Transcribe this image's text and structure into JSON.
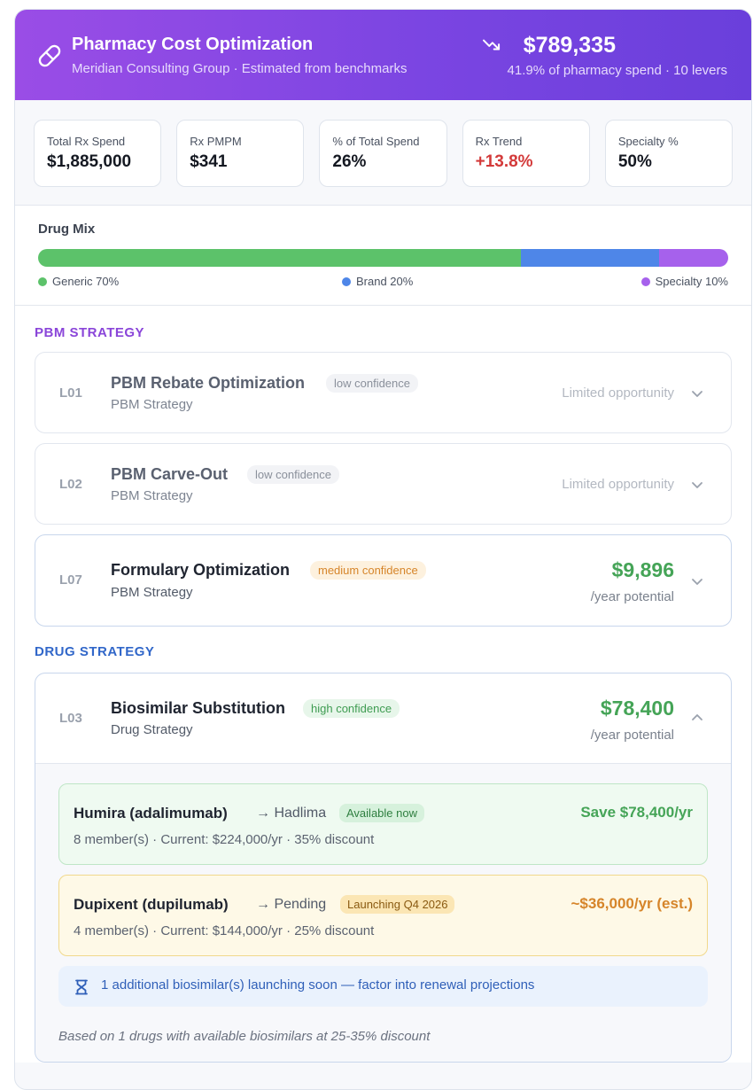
{
  "header": {
    "title": "Pharmacy Cost Optimization",
    "subtitle": "Meridian Consulting Group · Estimated from benchmarks",
    "total": "$789,335",
    "total_sub": "41.9% of pharmacy spend · 10 levers",
    "icons": {
      "logo": "pill-icon",
      "trend": "trending-down-icon"
    }
  },
  "stats": [
    {
      "label": "Total Rx Spend",
      "value": "$1,885,000"
    },
    {
      "label": "Rx PMPM",
      "value": "$341"
    },
    {
      "label": "% of Total Spend",
      "value": "26%"
    },
    {
      "label": "Rx Trend",
      "value": "+13.8%"
    },
    {
      "label": "Specialty %",
      "value": "50%"
    }
  ],
  "drug_mix": {
    "title": "Drug Mix",
    "segments": [
      {
        "label": "Generic 70%",
        "percent": 70,
        "color": "#5cc26a"
      },
      {
        "label": "Brand 20%",
        "percent": 20,
        "color": "#4e86e8"
      },
      {
        "label": "Specialty 10%",
        "percent": 10,
        "color": "#a661ec"
      }
    ]
  },
  "sections": {
    "pbm": {
      "title": "PBM STRATEGY"
    },
    "drug": {
      "title": "DRUG STRATEGY"
    }
  },
  "levers": {
    "l01": {
      "code": "L01",
      "name": "PBM Rebate Optimization",
      "confidence": "low confidence",
      "category": "PBM Strategy",
      "status": "Limited opportunity"
    },
    "l02": {
      "code": "L02",
      "name": "PBM Carve-Out",
      "confidence": "low confidence",
      "category": "PBM Strategy",
      "status": "Limited opportunity"
    },
    "l07": {
      "code": "L07",
      "name": "Formulary Optimization",
      "confidence": "medium confidence",
      "category": "PBM Strategy",
      "amount": "$9,896",
      "per": "/year potential"
    },
    "l03": {
      "code": "L03",
      "name": "Biosimilar Substitution",
      "confidence": "high confidence",
      "category": "Drug Strategy",
      "amount": "$78,400",
      "per": "/year potential",
      "drugs": [
        {
          "name": "Humira (adalimumab)",
          "arrow": "→ Hadlima",
          "tag": "Available now",
          "save": "Save $78,400/yr",
          "detail": "8 member(s) · Current: $224,000/yr · 35% discount"
        },
        {
          "name": "Dupixent (dupilumab)",
          "arrow": "→ Pending",
          "tag": "Launching Q4 2026",
          "save": "~$36,000/yr (est.)",
          "detail": "4 member(s) · Current: $144,000/yr · 25% discount"
        }
      ],
      "notice": "1 additional biosimilar(s) launching soon — factor into renewal projections",
      "footnote": "Based on 1 drugs with available biosimilars at 25-35% discount"
    }
  }
}
